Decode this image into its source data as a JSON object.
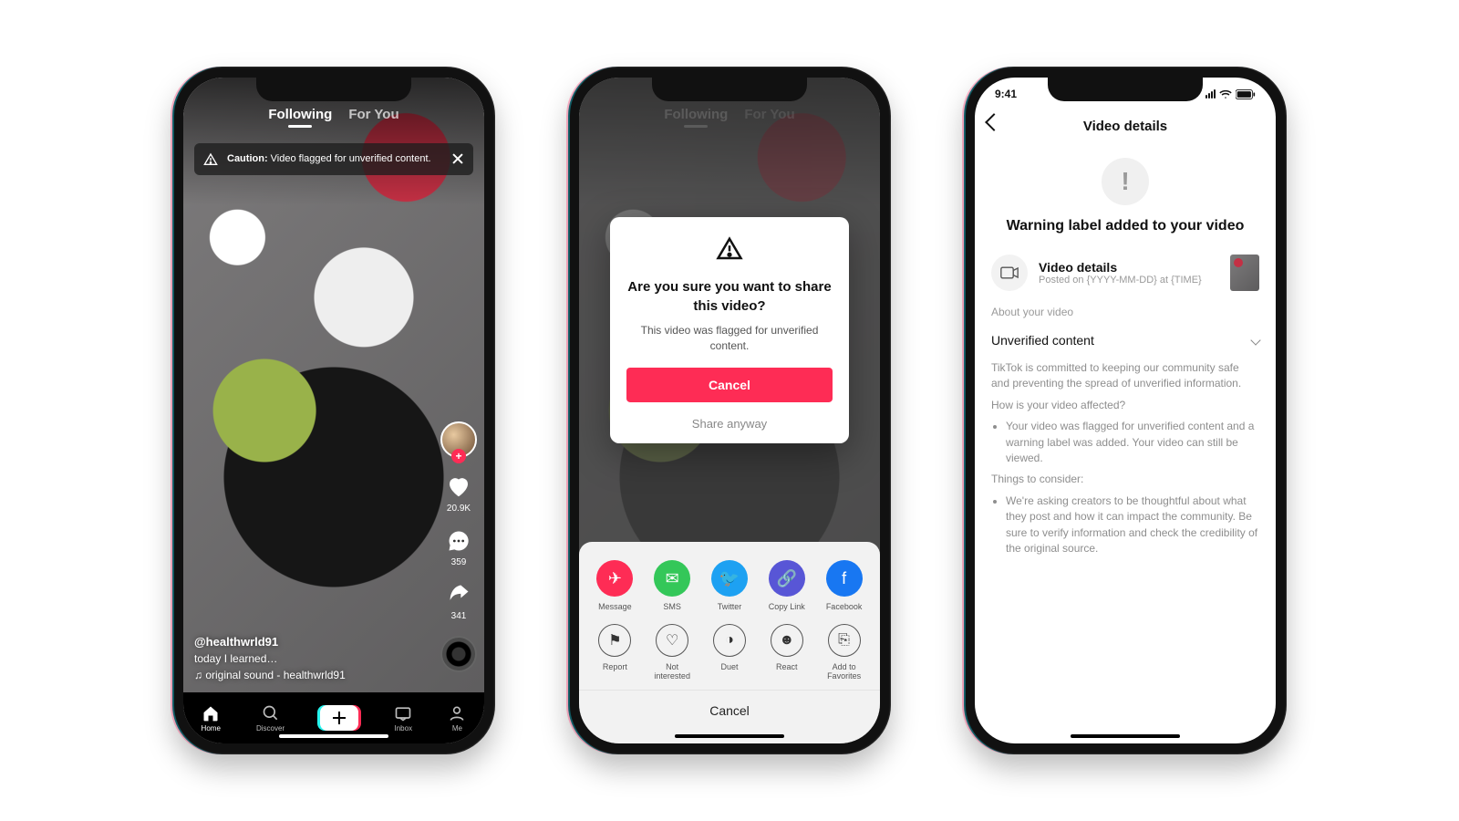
{
  "phone1": {
    "tabs": {
      "following": "Following",
      "for_you": "For You"
    },
    "banner": {
      "strong": "Caution:",
      "rest": " Video flagged for unverified content."
    },
    "rail": {
      "likes": "20.9K",
      "comments": "359",
      "shares": "341"
    },
    "meta": {
      "handle": "@healthwrld91",
      "caption": "today I learned…",
      "sound": "♫ original sound - healthwrld91"
    },
    "tabbar": {
      "home": "Home",
      "discover": "Discover",
      "inbox": "Inbox",
      "me": "Me"
    }
  },
  "phone2": {
    "tabs": {
      "following": "Following",
      "for_you": "For You"
    },
    "modal": {
      "title": "Are you sure you want to share this video?",
      "body": "This video was flagged for unverified content.",
      "primary": "Cancel",
      "secondary": "Share anyway"
    },
    "share_row1": [
      {
        "label": "Message",
        "color": "#fe2c55",
        "glyph": "✈"
      },
      {
        "label": "SMS",
        "color": "#34c759",
        "glyph": "✉"
      },
      {
        "label": "Twitter",
        "color": "#1da1f2",
        "glyph": "🐦"
      },
      {
        "label": "Copy Link",
        "color": "#5856d6",
        "glyph": "🔗"
      },
      {
        "label": "Facebook",
        "color": "#1877f2",
        "glyph": "f"
      }
    ],
    "share_row2": [
      {
        "label": "Report",
        "glyph": "⚑"
      },
      {
        "label": "Not interested",
        "glyph": "♡"
      },
      {
        "label": "Duet",
        "glyph": "◑"
      },
      {
        "label": "React",
        "glyph": "☻"
      },
      {
        "label": "Add to Favorites",
        "glyph": "⎘"
      }
    ],
    "sheet_cancel": "Cancel"
  },
  "phone3": {
    "time": "9:41",
    "header": "Video details",
    "warning_title": "Warning label added to your video",
    "details_row": {
      "title": "Video details",
      "subtitle": "Posted on {YYYY-MM-DD} at {TIME}"
    },
    "section_about": "About your video",
    "expand_label": "Unverified content",
    "para_commit": "TikTok is committed to keeping our community safe and preventing the spread of unverified information.",
    "q_affected": "How is your video affected?",
    "bullet_affected": "Your video was flagged for unverified content and a warning label was added. Your video can still be viewed.",
    "q_consider": "Things to consider:",
    "bullet_consider": "We're asking creators to be thoughtful about what they post and how it can impact the community. Be sure to verify information and check the credibility of the original source."
  }
}
